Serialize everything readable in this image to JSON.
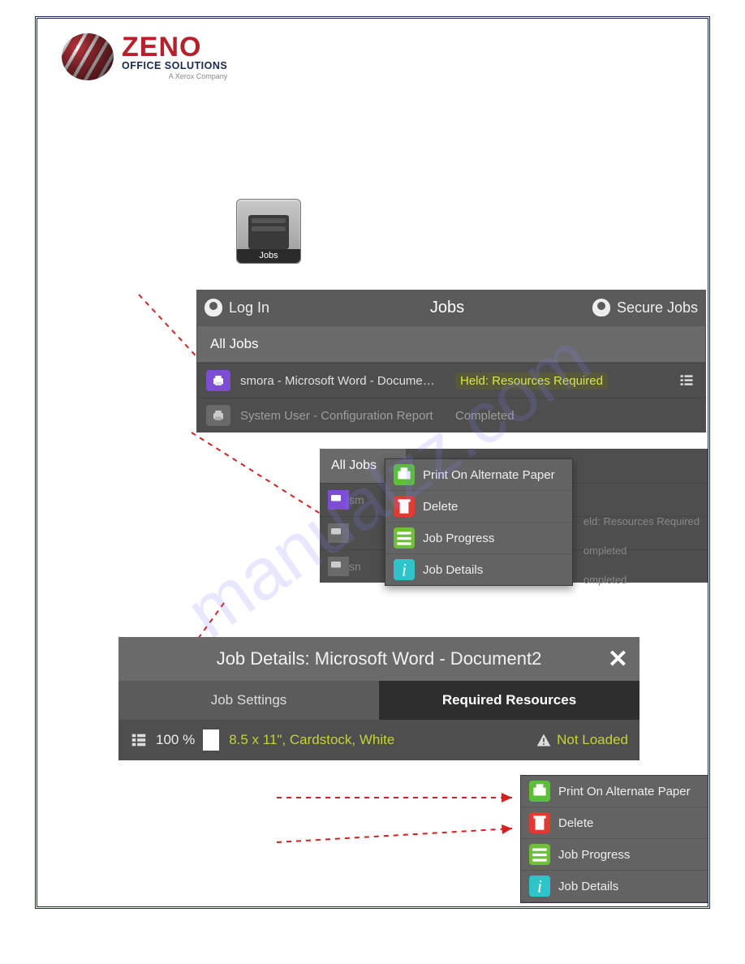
{
  "logo": {
    "main": "ZENO",
    "sub": "OFFICE SOLUTIONS",
    "tag": "A Xerox Company"
  },
  "jobs_tile": {
    "label": "Jobs"
  },
  "panel1": {
    "login": "Log In",
    "title": "Jobs",
    "secure": "Secure Jobs",
    "subheader": "All Jobs",
    "rows": [
      {
        "name": "smora - Microsoft Word - Docume…",
        "status": "Held: Resources Required"
      },
      {
        "name": "System User - Configuration Report",
        "status": "Completed"
      }
    ]
  },
  "panel2": {
    "subheader": "All Jobs",
    "bg_rows": [
      {
        "name": "sm",
        "status": "eld: Resources Required"
      },
      {
        "name": "",
        "status": "ompleted"
      },
      {
        "name": "sn",
        "status": "ompleted"
      }
    ],
    "popup": [
      {
        "label": "Print On Alternate Paper",
        "icon": "green"
      },
      {
        "label": "Delete",
        "icon": "red"
      },
      {
        "label": "Job Progress",
        "icon": "green2"
      },
      {
        "label": "Job Details",
        "icon": "cyan"
      }
    ]
  },
  "panel3": {
    "title": "Job Details: Microsoft Word - Document2",
    "tab_inactive": "Job Settings",
    "tab_active": "Required Resources",
    "percent": "100 %",
    "resource": "8.5 x 11\", Cardstock, White",
    "warn": "Not Loaded"
  },
  "panel4": {
    "items": [
      {
        "label": "Print On Alternate Paper",
        "icon": "green"
      },
      {
        "label": "Delete",
        "icon": "red"
      },
      {
        "label": "Job Progress",
        "icon": "green2"
      },
      {
        "label": "Job Details",
        "icon": "cyan"
      }
    ]
  }
}
